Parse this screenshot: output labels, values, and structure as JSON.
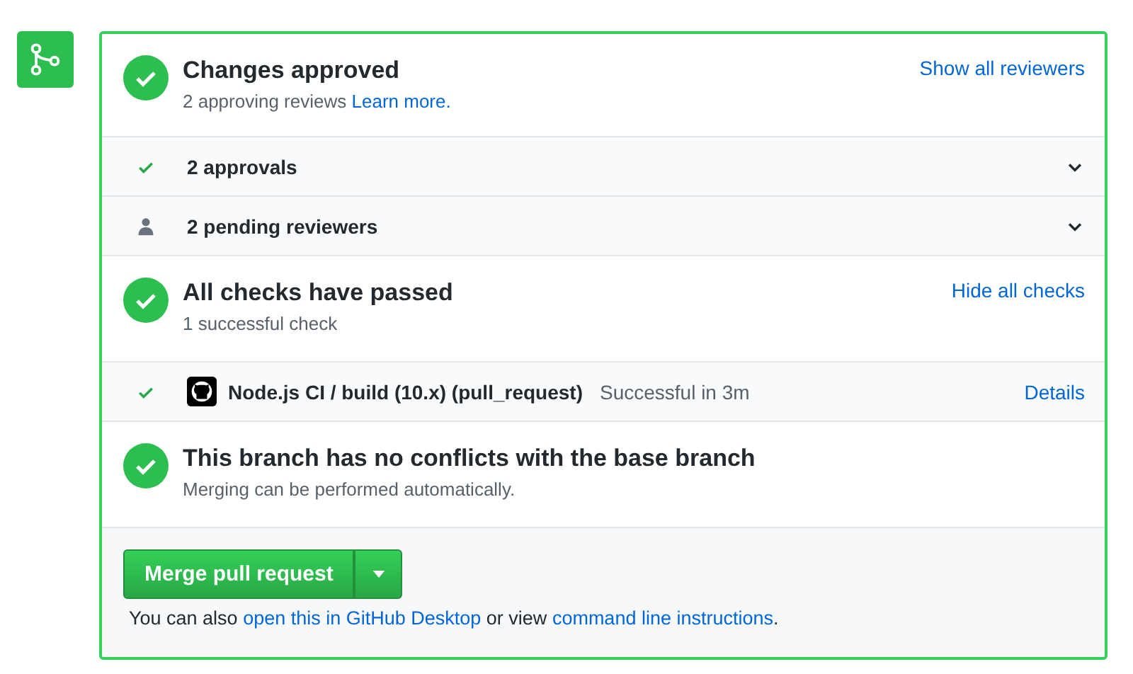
{
  "review_summary": {
    "title": "Changes approved",
    "subtitle": "2 approving reviews",
    "link": "Learn more.",
    "action": "Show all reviewers"
  },
  "review_rows": [
    {
      "kind": "approved",
      "label": "2 approvals"
    },
    {
      "kind": "pending",
      "label": "2 pending reviewers"
    }
  ],
  "checks_summary": {
    "title": "All checks have passed",
    "subtitle": "1 successful check",
    "action": "Hide all checks"
  },
  "check_runs": [
    {
      "name": "Node.js CI / build (10.x) (pull_request)",
      "status": "Successful in 3m",
      "link": "Details"
    }
  ],
  "conflicts": {
    "title": "This branch has no conflicts with the base branch",
    "subtitle": "Merging can be performed automatically."
  },
  "merge": {
    "button": "Merge pull request",
    "note": [
      {
        "kind": "text",
        "text": "You can also "
      },
      {
        "kind": "link",
        "text": "open this in GitHub Desktop"
      },
      {
        "kind": "text",
        "text": " or view "
      },
      {
        "kind": "link",
        "text": "command line instructions"
      },
      {
        "kind": "text",
        "text": "."
      }
    ]
  }
}
